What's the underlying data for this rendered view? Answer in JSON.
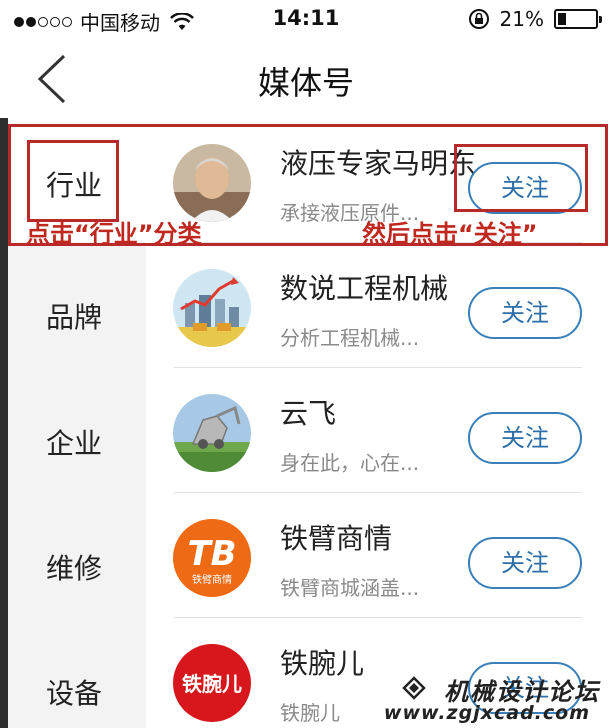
{
  "status_bar": {
    "carrier": "中国移动",
    "time": "14:11",
    "battery_percent": "21%",
    "battery_level": 0.21
  },
  "nav": {
    "title": "媒体号",
    "back_icon": "chevron-left-icon"
  },
  "sidebar": {
    "items": [
      {
        "label": "行业",
        "active": true
      },
      {
        "label": "品牌",
        "active": false
      },
      {
        "label": "企业",
        "active": false
      },
      {
        "label": "维修",
        "active": false
      },
      {
        "label": "设备",
        "active": false
      }
    ]
  },
  "list": {
    "rows": [
      {
        "name": "液压专家马明东",
        "desc": "承接液压原件...",
        "button": "关注",
        "avatar": "portrait-avatar"
      },
      {
        "name": "数说工程机械",
        "desc": "分析工程机械...",
        "button": "关注",
        "avatar": "city-chart-avatar"
      },
      {
        "name": "云飞",
        "desc": "身在此，心在...",
        "button": "关注",
        "avatar": "excavator-avatar"
      },
      {
        "name": "铁臂商情",
        "desc": "铁臂商城涵盖...",
        "button": "关注",
        "avatar": "tb-logo-avatar"
      },
      {
        "name": "铁腕儿",
        "desc": "铁腕儿",
        "button": "关注",
        "avatar": "tiewaner-logo-avatar"
      }
    ],
    "tb_logo_text": "TB",
    "tb_logo_sub": "铁臂商情",
    "tiewaner_logo_text": "铁腕儿"
  },
  "annotations": {
    "left_note": "点击“行业”分类",
    "right_note": "然后点击“关注”",
    "color": "#c0281f"
  },
  "watermark": {
    "line1": "机械设计论坛",
    "line2": "www.zgjxcad.com"
  }
}
